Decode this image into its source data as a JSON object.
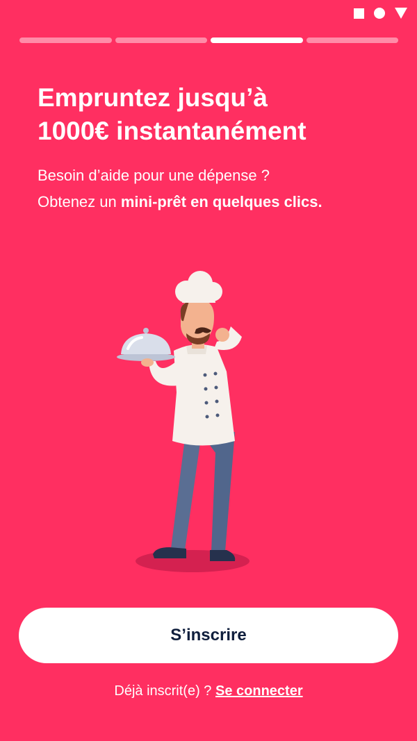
{
  "status_bar": {
    "icons": [
      "square-icon",
      "circle-icon",
      "triangle-icon"
    ]
  },
  "progress": {
    "total_steps": 4,
    "active_step": 3
  },
  "headline": {
    "line1": "Empruntez jusqu’à",
    "line2": "1000€ instantanément"
  },
  "subtitle": {
    "line1": "Besoin d’aide pour une dépense ?",
    "line2_prefix": "Obtenez un ",
    "line2_bold": "mini-prêt en quelques clics."
  },
  "illustration": {
    "icon": "chef-with-cloche-illustration"
  },
  "cta": {
    "label": "S’inscrire"
  },
  "login": {
    "prompt": "Déjà inscrit(e) ? ",
    "link_label": "Se connecter"
  },
  "colors": {
    "background": "#FF2F61",
    "button_text": "#0F1E3C"
  }
}
